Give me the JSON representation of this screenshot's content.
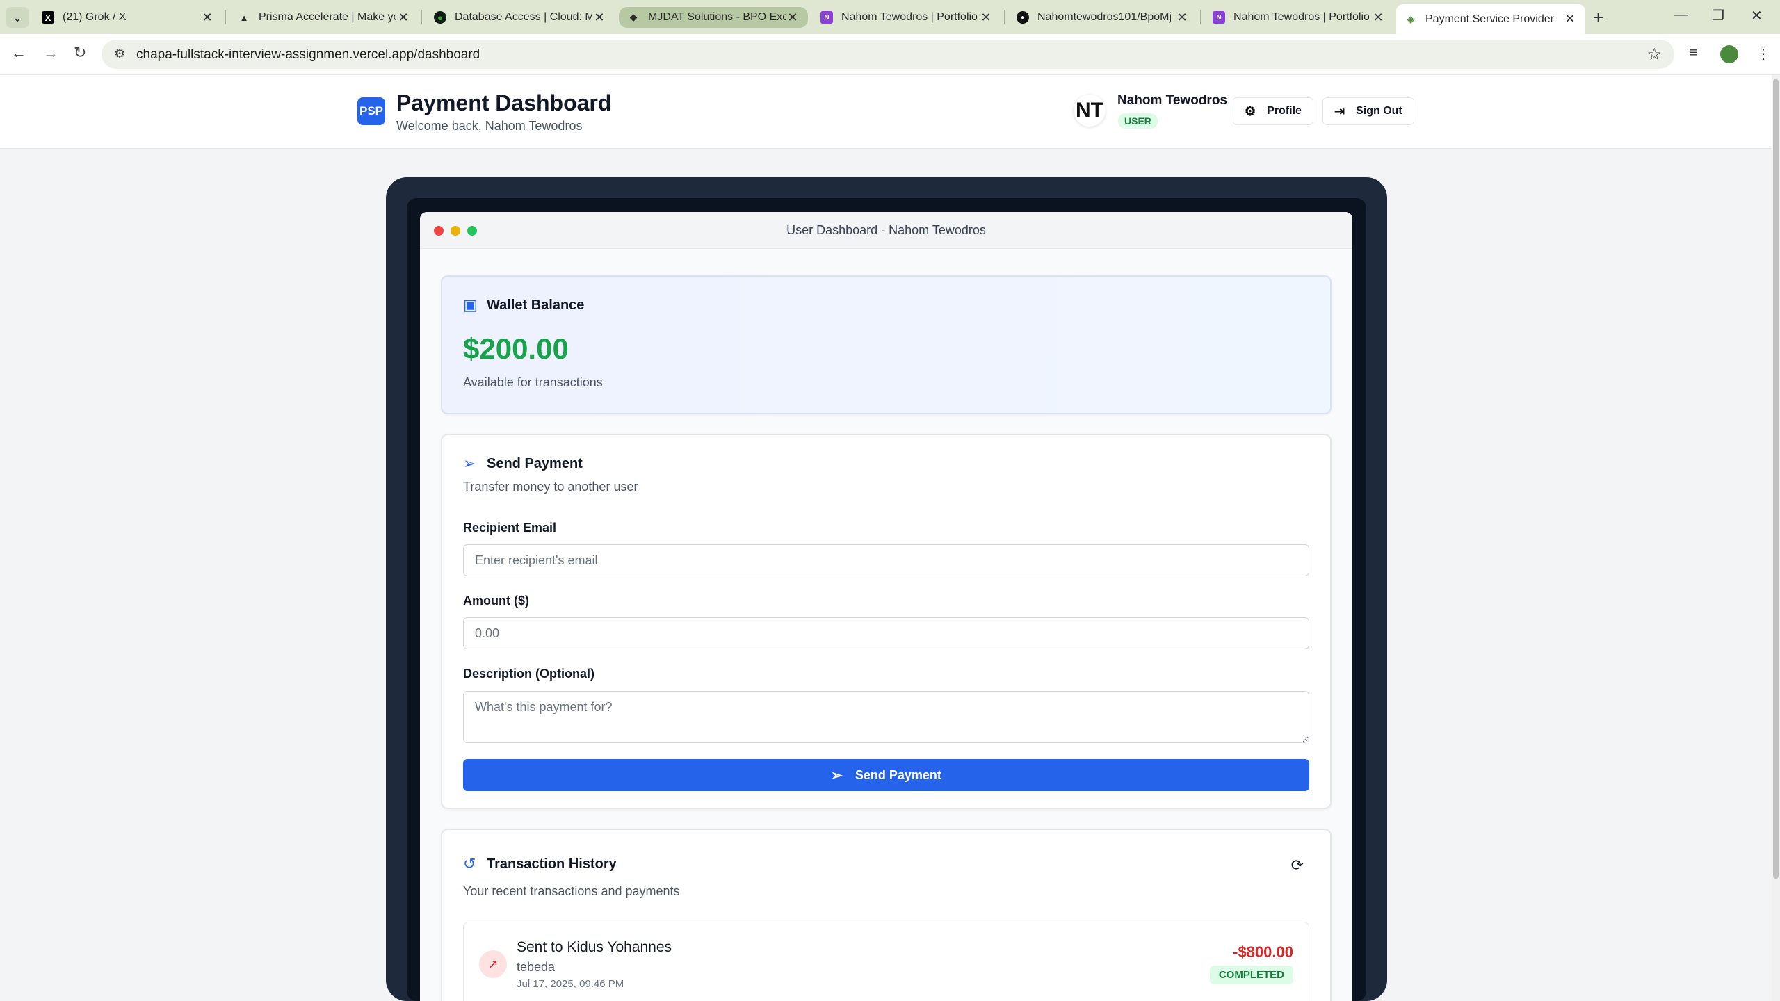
{
  "browser": {
    "tabs": [
      {
        "title": "(21) Grok / X",
        "favicon": "x-logo-icon"
      },
      {
        "title": "Prisma Accelerate | Make yo",
        "favicon": "prisma-icon"
      },
      {
        "title": "Database Access | Cloud: Mo",
        "favicon": "mongodb-leaf-icon"
      },
      {
        "title": "MJDAT Solutions - BPO Exce",
        "favicon": "mjdat-icon"
      },
      {
        "title": "Nahom Tewodros | Portfolio",
        "favicon": "portfolio-icon"
      },
      {
        "title": "Nahomtewodros101/BpoMj",
        "favicon": "github-icon"
      },
      {
        "title": "Nahom Tewodros | Portfolio",
        "favicon": "portfolio-icon"
      },
      {
        "title": "Payment Service Provider",
        "favicon": "payment-icon"
      }
    ],
    "url": "chapa-fullstack-interview-assignmen.vercel.app/dashboard"
  },
  "header": {
    "logo": "PSP",
    "title": "Payment Dashboard",
    "subtitle": "Welcome back, Nahom Tewodros",
    "avatar_initials": "NT",
    "user_name": "Nahom Tewodros",
    "user_role": "USER",
    "profile_label": "Profile",
    "signout_label": "Sign Out"
  },
  "window": {
    "title": "User Dashboard - Nahom Tewodros"
  },
  "wallet": {
    "title": "Wallet Balance",
    "balance": "$200.00",
    "caption": "Available for transactions"
  },
  "send_payment": {
    "title": "Send Payment",
    "subtitle": "Transfer money to another user",
    "recipient_label": "Recipient Email",
    "recipient_placeholder": "Enter recipient's email",
    "amount_label": "Amount ($)",
    "amount_placeholder": "0.00",
    "description_label": "Description (Optional)",
    "description_placeholder": "What's this payment for?",
    "button_label": "Send Payment"
  },
  "history": {
    "title": "Transaction History",
    "subtitle": "Your recent transactions and payments",
    "transactions": [
      {
        "title": "Sent to Kidus Yohannes",
        "description": "tebeda",
        "date": "Jul 17, 2025, 09:46 PM",
        "amount": "-$800.00",
        "status": "COMPLETED"
      }
    ]
  },
  "colors": {
    "primary": "#2563eb",
    "balance_green": "#16a34a",
    "debit_red": "#dc2626",
    "status_bg": "#dcfce7"
  }
}
